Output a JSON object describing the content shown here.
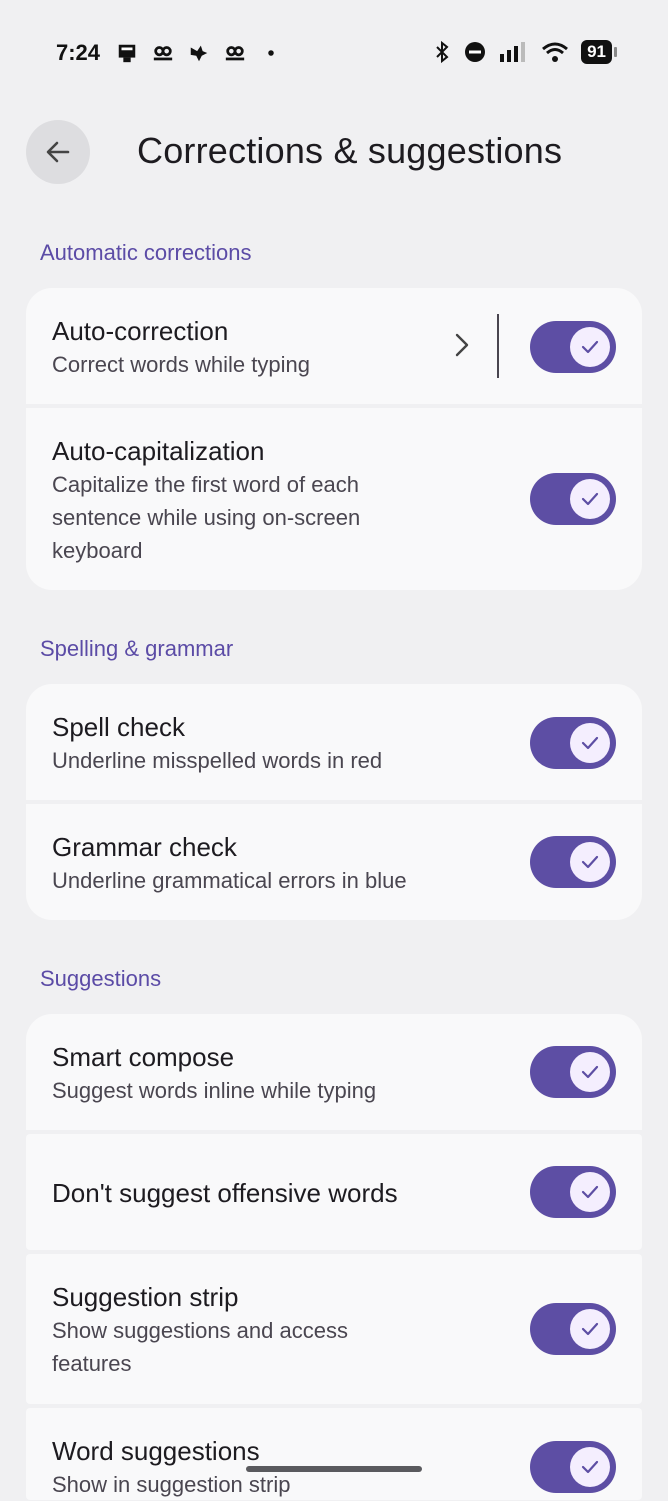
{
  "status_bar": {
    "time": "7:24",
    "notification_icons": [
      "phone-icon",
      "hood-icon",
      "bird-icon",
      "hood-icon",
      "dot-icon"
    ],
    "system_icons": [
      "bluetooth-icon",
      "dnd-icon",
      "signal-icon",
      "wifi-icon"
    ],
    "battery": "91"
  },
  "header": {
    "title": "Corrections & suggestions",
    "back_icon": "arrow-back-icon"
  },
  "sections": {
    "auto": {
      "title": "Automatic corrections",
      "items": [
        {
          "title": "Auto-correction",
          "subtitle": "Correct words while typing",
          "enabled": true
        },
        {
          "title": "Auto-capitalization",
          "subtitle": "Capitalize the first word of each sentence while using on-screen keyboard",
          "enabled": true
        }
      ]
    },
    "spelling": {
      "title": "Spelling & grammar",
      "items": [
        {
          "title": "Spell check",
          "subtitle": "Underline misspelled words in red",
          "enabled": true
        },
        {
          "title": "Grammar check",
          "subtitle": "Underline grammatical errors in blue",
          "enabled": true
        }
      ]
    },
    "suggestions": {
      "title": "Suggestions",
      "items": [
        {
          "title": "Smart compose",
          "subtitle": "Suggest words inline while typing",
          "enabled": true
        },
        {
          "title": "Don't suggest offensive words",
          "subtitle": "",
          "enabled": true
        },
        {
          "title": "Suggestion strip",
          "subtitle": "Show suggestions and access features",
          "enabled": true
        },
        {
          "title": "Word suggestions",
          "subtitle": "Show in suggestion strip",
          "enabled": true
        }
      ]
    }
  },
  "colors": {
    "accent": "#5d4ea4",
    "section_header": "#5b4ba6",
    "background": "#f0f0f2",
    "card": "#f9f9fa"
  }
}
